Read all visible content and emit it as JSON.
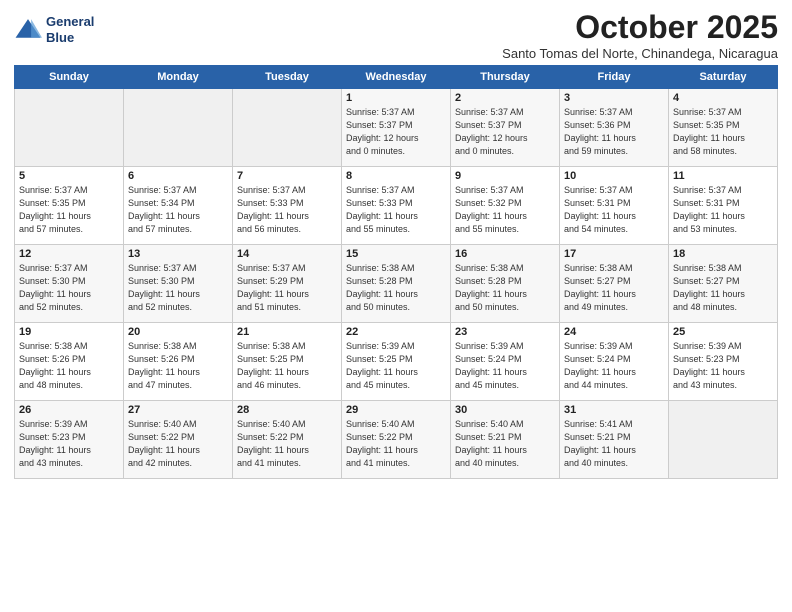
{
  "header": {
    "logo_line1": "General",
    "logo_line2": "Blue",
    "month": "October 2025",
    "location": "Santo Tomas del Norte, Chinandega, Nicaragua"
  },
  "weekdays": [
    "Sunday",
    "Monday",
    "Tuesday",
    "Wednesday",
    "Thursday",
    "Friday",
    "Saturday"
  ],
  "weeks": [
    [
      {
        "day": "",
        "info": ""
      },
      {
        "day": "",
        "info": ""
      },
      {
        "day": "",
        "info": ""
      },
      {
        "day": "1",
        "info": "Sunrise: 5:37 AM\nSunset: 5:37 PM\nDaylight: 12 hours\nand 0 minutes."
      },
      {
        "day": "2",
        "info": "Sunrise: 5:37 AM\nSunset: 5:37 PM\nDaylight: 12 hours\nand 0 minutes."
      },
      {
        "day": "3",
        "info": "Sunrise: 5:37 AM\nSunset: 5:36 PM\nDaylight: 11 hours\nand 59 minutes."
      },
      {
        "day": "4",
        "info": "Sunrise: 5:37 AM\nSunset: 5:35 PM\nDaylight: 11 hours\nand 58 minutes."
      }
    ],
    [
      {
        "day": "5",
        "info": "Sunrise: 5:37 AM\nSunset: 5:35 PM\nDaylight: 11 hours\nand 57 minutes."
      },
      {
        "day": "6",
        "info": "Sunrise: 5:37 AM\nSunset: 5:34 PM\nDaylight: 11 hours\nand 57 minutes."
      },
      {
        "day": "7",
        "info": "Sunrise: 5:37 AM\nSunset: 5:33 PM\nDaylight: 11 hours\nand 56 minutes."
      },
      {
        "day": "8",
        "info": "Sunrise: 5:37 AM\nSunset: 5:33 PM\nDaylight: 11 hours\nand 55 minutes."
      },
      {
        "day": "9",
        "info": "Sunrise: 5:37 AM\nSunset: 5:32 PM\nDaylight: 11 hours\nand 55 minutes."
      },
      {
        "day": "10",
        "info": "Sunrise: 5:37 AM\nSunset: 5:31 PM\nDaylight: 11 hours\nand 54 minutes."
      },
      {
        "day": "11",
        "info": "Sunrise: 5:37 AM\nSunset: 5:31 PM\nDaylight: 11 hours\nand 53 minutes."
      }
    ],
    [
      {
        "day": "12",
        "info": "Sunrise: 5:37 AM\nSunset: 5:30 PM\nDaylight: 11 hours\nand 52 minutes."
      },
      {
        "day": "13",
        "info": "Sunrise: 5:37 AM\nSunset: 5:30 PM\nDaylight: 11 hours\nand 52 minutes."
      },
      {
        "day": "14",
        "info": "Sunrise: 5:37 AM\nSunset: 5:29 PM\nDaylight: 11 hours\nand 51 minutes."
      },
      {
        "day": "15",
        "info": "Sunrise: 5:38 AM\nSunset: 5:28 PM\nDaylight: 11 hours\nand 50 minutes."
      },
      {
        "day": "16",
        "info": "Sunrise: 5:38 AM\nSunset: 5:28 PM\nDaylight: 11 hours\nand 50 minutes."
      },
      {
        "day": "17",
        "info": "Sunrise: 5:38 AM\nSunset: 5:27 PM\nDaylight: 11 hours\nand 49 minutes."
      },
      {
        "day": "18",
        "info": "Sunrise: 5:38 AM\nSunset: 5:27 PM\nDaylight: 11 hours\nand 48 minutes."
      }
    ],
    [
      {
        "day": "19",
        "info": "Sunrise: 5:38 AM\nSunset: 5:26 PM\nDaylight: 11 hours\nand 48 minutes."
      },
      {
        "day": "20",
        "info": "Sunrise: 5:38 AM\nSunset: 5:26 PM\nDaylight: 11 hours\nand 47 minutes."
      },
      {
        "day": "21",
        "info": "Sunrise: 5:38 AM\nSunset: 5:25 PM\nDaylight: 11 hours\nand 46 minutes."
      },
      {
        "day": "22",
        "info": "Sunrise: 5:39 AM\nSunset: 5:25 PM\nDaylight: 11 hours\nand 45 minutes."
      },
      {
        "day": "23",
        "info": "Sunrise: 5:39 AM\nSunset: 5:24 PM\nDaylight: 11 hours\nand 45 minutes."
      },
      {
        "day": "24",
        "info": "Sunrise: 5:39 AM\nSunset: 5:24 PM\nDaylight: 11 hours\nand 44 minutes."
      },
      {
        "day": "25",
        "info": "Sunrise: 5:39 AM\nSunset: 5:23 PM\nDaylight: 11 hours\nand 43 minutes."
      }
    ],
    [
      {
        "day": "26",
        "info": "Sunrise: 5:39 AM\nSunset: 5:23 PM\nDaylight: 11 hours\nand 43 minutes."
      },
      {
        "day": "27",
        "info": "Sunrise: 5:40 AM\nSunset: 5:22 PM\nDaylight: 11 hours\nand 42 minutes."
      },
      {
        "day": "28",
        "info": "Sunrise: 5:40 AM\nSunset: 5:22 PM\nDaylight: 11 hours\nand 41 minutes."
      },
      {
        "day": "29",
        "info": "Sunrise: 5:40 AM\nSunset: 5:22 PM\nDaylight: 11 hours\nand 41 minutes."
      },
      {
        "day": "30",
        "info": "Sunrise: 5:40 AM\nSunset: 5:21 PM\nDaylight: 11 hours\nand 40 minutes."
      },
      {
        "day": "31",
        "info": "Sunrise: 5:41 AM\nSunset: 5:21 PM\nDaylight: 11 hours\nand 40 minutes."
      },
      {
        "day": "",
        "info": ""
      }
    ]
  ]
}
